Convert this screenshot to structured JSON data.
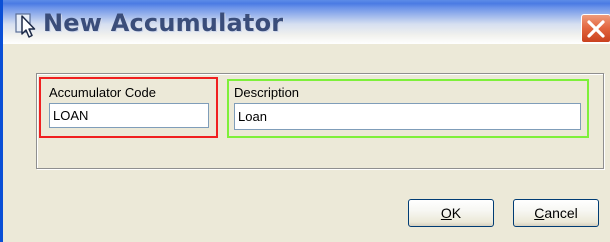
{
  "window": {
    "title": "New Accumulator",
    "icon": "pointer-arrow-icon",
    "close_icon": "close-icon"
  },
  "form": {
    "accumulator_code": {
      "label": "Accumulator Code",
      "value": "LOAN"
    },
    "description": {
      "label": "Description",
      "value": "Loan"
    }
  },
  "buttons": {
    "ok": {
      "mnemonic": "O",
      "rest": "K"
    },
    "cancel": {
      "mnemonic": "C",
      "rest": "ancel"
    }
  },
  "colors": {
    "code_highlight": "#f02020",
    "description_highlight": "#7ef03a",
    "close_button": "#e2643d",
    "window_border": "#0a4fd6",
    "dialog_background": "#ece9d8"
  }
}
